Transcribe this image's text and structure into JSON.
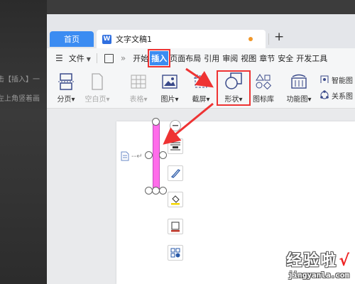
{
  "background_fragments": {
    "line1": "击【插入】一",
    "line2": "左上角竖着画"
  },
  "tabs": {
    "home_label": "首页",
    "doc_title": "文字文稿1",
    "doc_icon_letter": "W",
    "add_label": "+"
  },
  "menubar": {
    "file_label": "文件",
    "more_label": "»",
    "tabs": [
      "开始",
      "插入",
      "页面布局",
      "引用",
      "审阅",
      "视图",
      "章节",
      "安全",
      "开发工具"
    ],
    "active_tab": "插入"
  },
  "ribbon": {
    "page_break": "分页",
    "blank_page": "空白页",
    "table": "表格",
    "picture": "图片",
    "screenshot": "截屏",
    "shape": "形状",
    "icon_library": "图标库",
    "function_chart": "功能图",
    "smart_graphic": "智能图",
    "relation_chart": "关系图"
  },
  "colors": {
    "accent": "#3b8cf2",
    "highlight": "#e33333",
    "shape_fill": "#ff6dea"
  },
  "watermark": {
    "brand": "经验啦",
    "url": "jingyanla.com"
  }
}
